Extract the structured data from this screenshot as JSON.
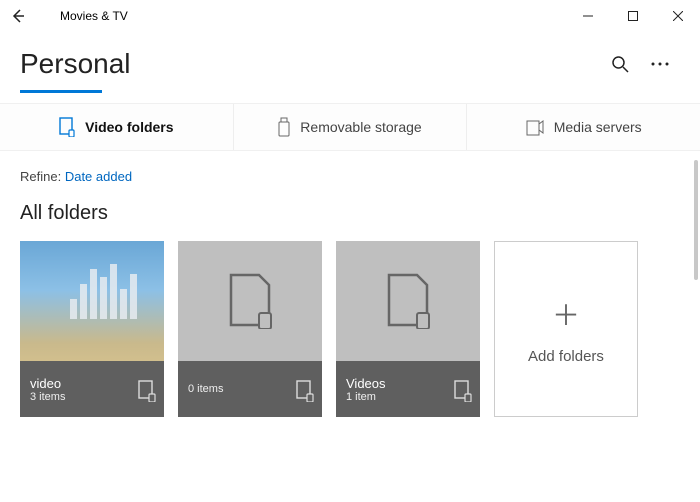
{
  "app": {
    "title": "Movies & TV"
  },
  "page": {
    "title": "Personal",
    "active_tab": 0,
    "tabs": [
      {
        "label": "Video folders",
        "icon": "folder-video"
      },
      {
        "label": "Removable storage",
        "icon": "usb"
      },
      {
        "label": "Media servers",
        "icon": "server"
      }
    ],
    "refine_label": "Refine:",
    "refine_value": "Date added",
    "section_title": "All folders",
    "folders": [
      {
        "name": "video",
        "count": "3 items",
        "kind": "photo"
      },
      {
        "name": "",
        "count": "0 items",
        "kind": "empty"
      },
      {
        "name": "Videos",
        "count": "1 item",
        "kind": "empty"
      }
    ],
    "add_tile": {
      "label": "Add folders"
    }
  }
}
